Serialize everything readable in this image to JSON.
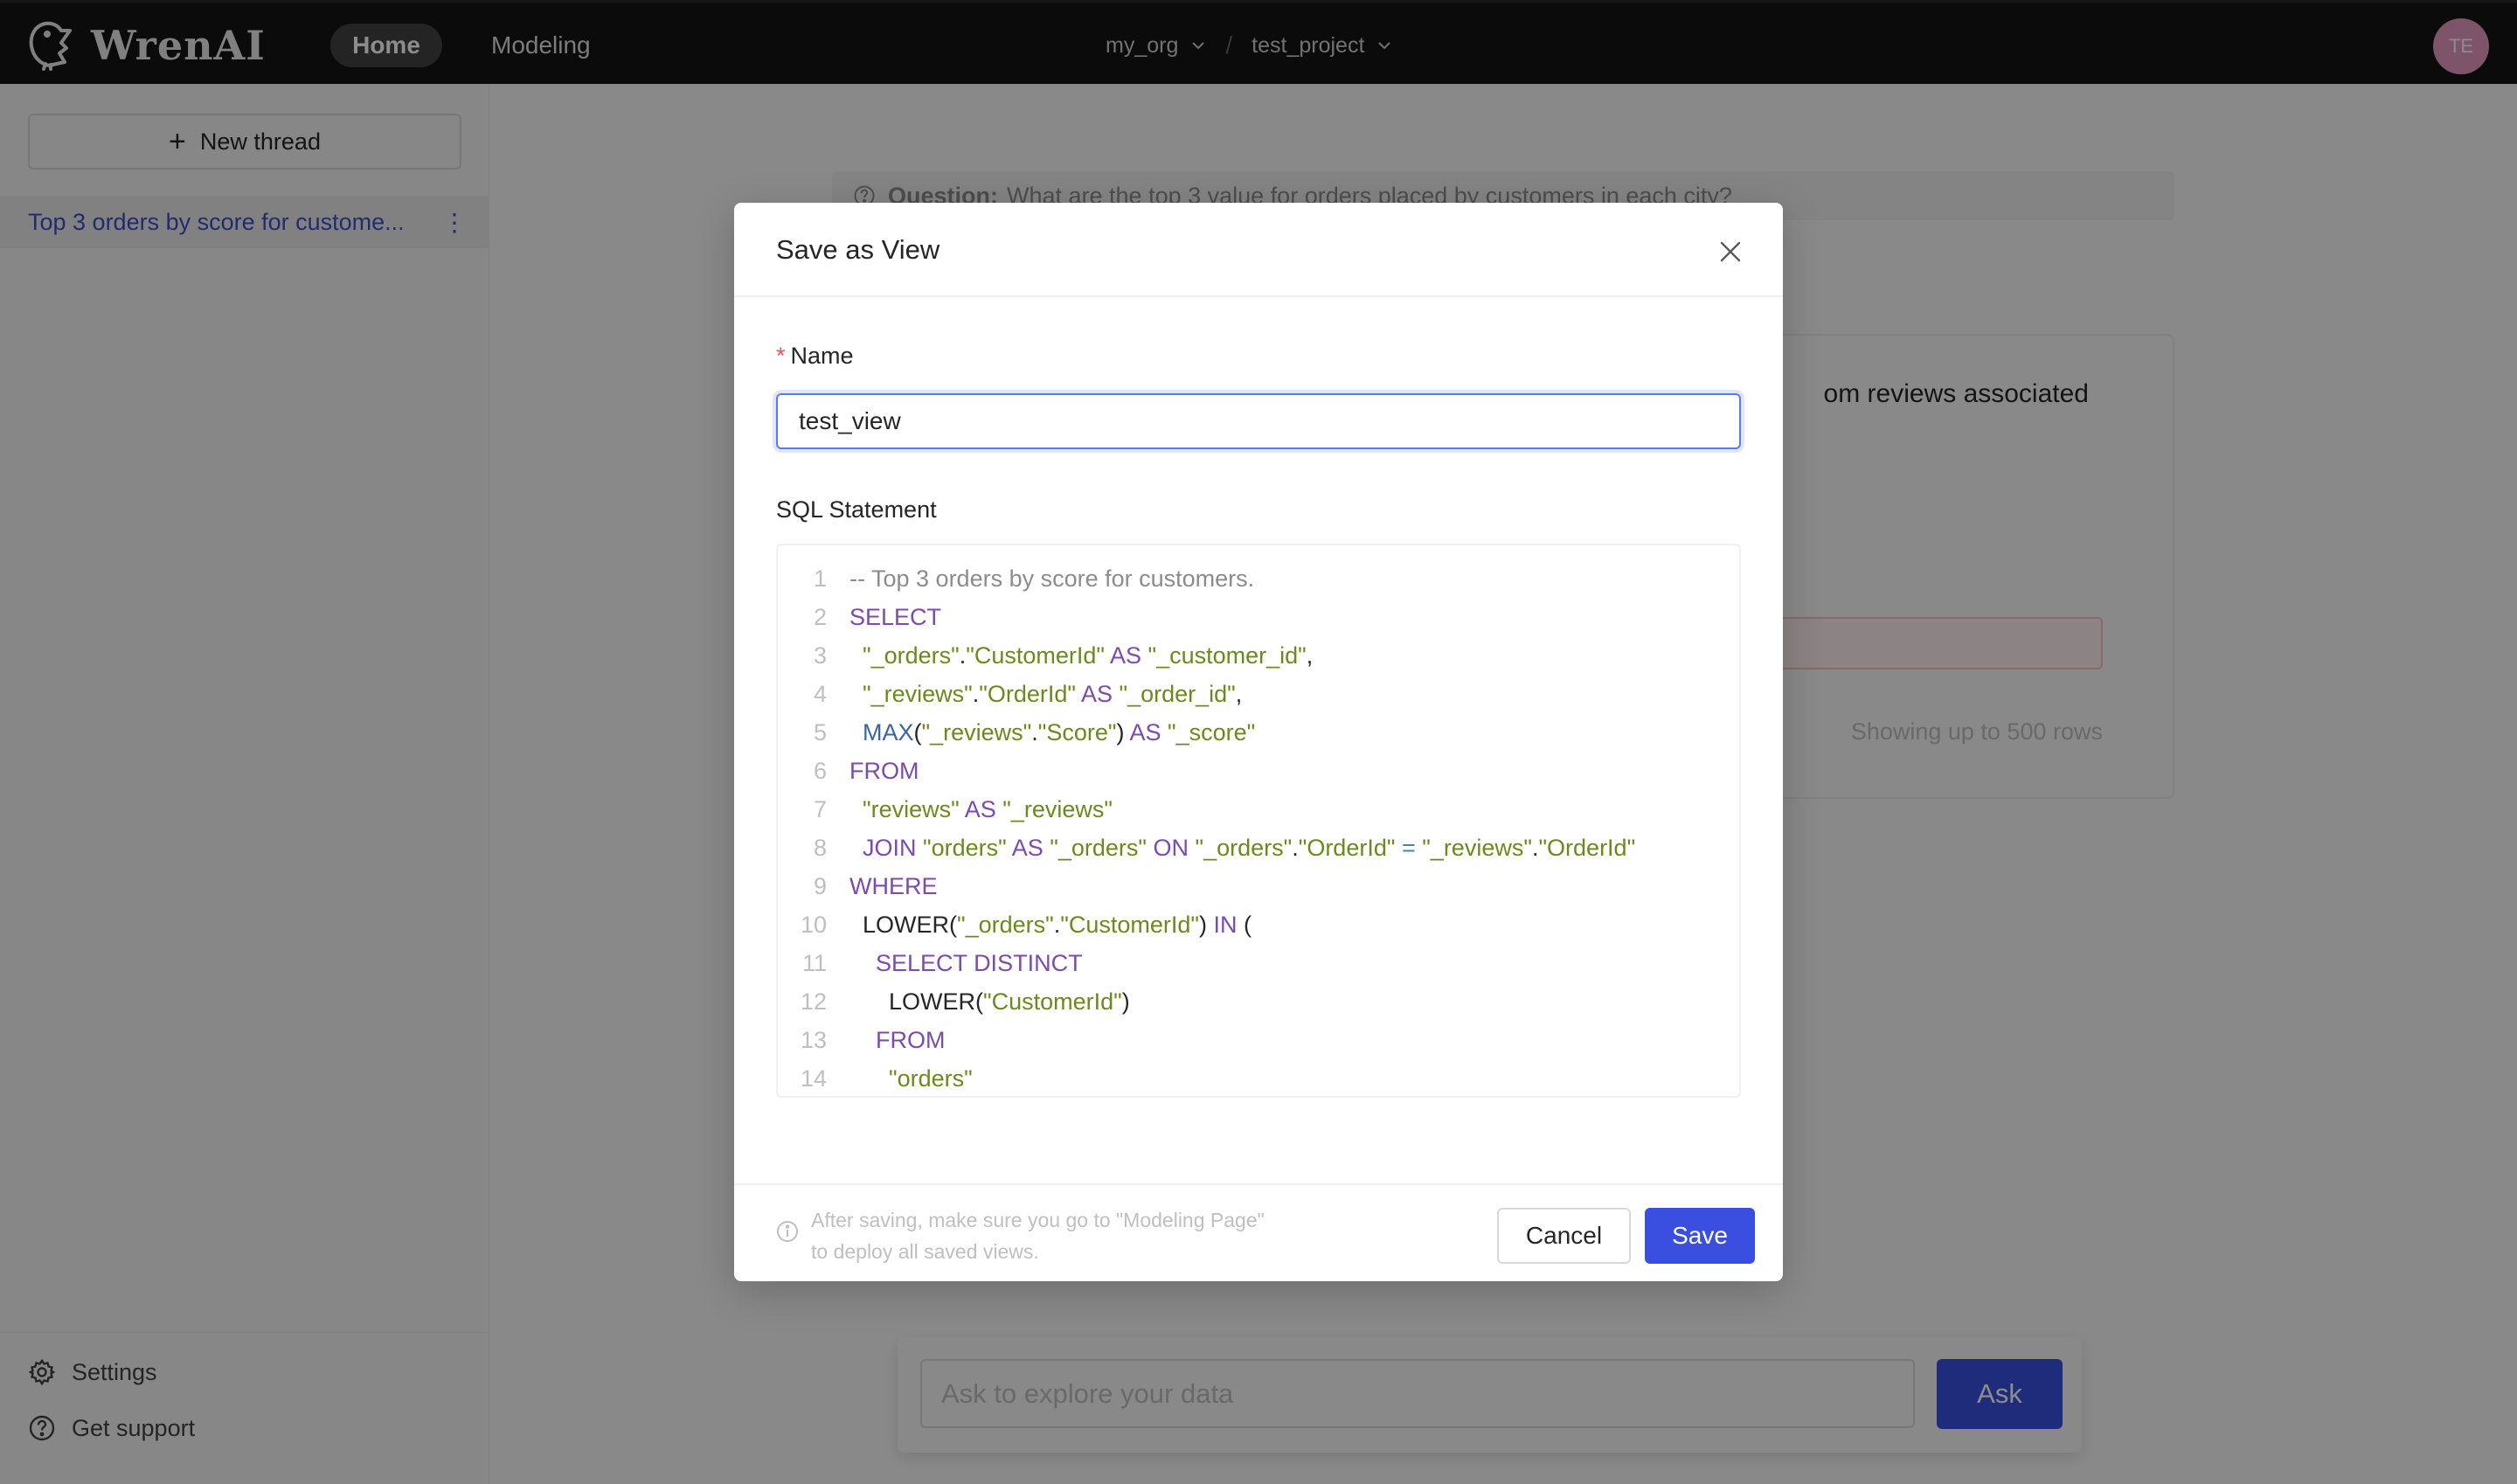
{
  "header": {
    "brand": "WrenAI",
    "nav": [
      {
        "label": "Home",
        "active": true
      },
      {
        "label": "Modeling",
        "active": false
      }
    ],
    "breadcrumb": {
      "org": "my_org",
      "separator": "/",
      "project": "test_project"
    },
    "avatar_initials": "TE",
    "avatar_color": "#e59ac2"
  },
  "sidebar": {
    "new_thread_label": "New thread",
    "threads": [
      {
        "label": "Top 3 orders by score for custome...",
        "active": true
      }
    ],
    "bottom_links": [
      {
        "label": "Settings",
        "icon": "gear-icon"
      },
      {
        "label": "Get support",
        "icon": "question-circle-icon"
      }
    ]
  },
  "main": {
    "question_label": "Question:",
    "question_text": "What are the top 3 value for orders placed by customers in each city?",
    "answer_text_visible": "om reviews associated",
    "rows_note": "Showing up to 500 rows",
    "ask": {
      "placeholder": "Ask to explore your data",
      "button_label": "Ask"
    }
  },
  "dialog": {
    "title": "Save as View",
    "name_label": "Name",
    "name_required_mark": "*",
    "name_value": "test_view",
    "sql_label": "SQL Statement",
    "sql_lines": [
      {
        "n": "1",
        "tokens": [
          {
            "t": "-- Top 3 orders by score for customers.",
            "c": "cm"
          }
        ]
      },
      {
        "n": "2",
        "tokens": [
          {
            "t": "SELECT",
            "c": "kw"
          }
        ]
      },
      {
        "n": "3",
        "tokens": [
          {
            "t": "  ",
            "c": "plain"
          },
          {
            "t": "\"_orders\"",
            "c": "str"
          },
          {
            "t": ".",
            "c": "plain"
          },
          {
            "t": "\"CustomerId\"",
            "c": "str"
          },
          {
            "t": " AS ",
            "c": "kw"
          },
          {
            "t": "\"_customer_id\"",
            "c": "str"
          },
          {
            "t": ",",
            "c": "plain"
          }
        ]
      },
      {
        "n": "4",
        "tokens": [
          {
            "t": "  ",
            "c": "plain"
          },
          {
            "t": "\"_reviews\"",
            "c": "str"
          },
          {
            "t": ".",
            "c": "plain"
          },
          {
            "t": "\"OrderId\"",
            "c": "str"
          },
          {
            "t": " AS ",
            "c": "kw"
          },
          {
            "t": "\"_order_id\"",
            "c": "str"
          },
          {
            "t": ",",
            "c": "plain"
          }
        ]
      },
      {
        "n": "5",
        "tokens": [
          {
            "t": "  ",
            "c": "plain"
          },
          {
            "t": "MAX",
            "c": "fn"
          },
          {
            "t": "(",
            "c": "plain"
          },
          {
            "t": "\"_reviews\"",
            "c": "str"
          },
          {
            "t": ".",
            "c": "plain"
          },
          {
            "t": "\"Score\"",
            "c": "str"
          },
          {
            "t": ")",
            "c": "plain"
          },
          {
            "t": " AS ",
            "c": "kw"
          },
          {
            "t": "\"_score\"",
            "c": "str"
          }
        ]
      },
      {
        "n": "6",
        "tokens": [
          {
            "t": "FROM",
            "c": "kw"
          }
        ]
      },
      {
        "n": "7",
        "tokens": [
          {
            "t": "  ",
            "c": "plain"
          },
          {
            "t": "\"reviews\"",
            "c": "str"
          },
          {
            "t": " AS ",
            "c": "kw"
          },
          {
            "t": "\"_reviews\"",
            "c": "str"
          }
        ]
      },
      {
        "n": "8",
        "tokens": [
          {
            "t": "  ",
            "c": "plain"
          },
          {
            "t": "JOIN ",
            "c": "kw"
          },
          {
            "t": "\"orders\"",
            "c": "str"
          },
          {
            "t": " AS ",
            "c": "kw"
          },
          {
            "t": "\"_orders\"",
            "c": "str"
          },
          {
            "t": " ON ",
            "c": "kw"
          },
          {
            "t": "\"_orders\"",
            "c": "str"
          },
          {
            "t": ".",
            "c": "plain"
          },
          {
            "t": "\"OrderId\"",
            "c": "str"
          },
          {
            "t": " = ",
            "c": "op"
          },
          {
            "t": "\"_reviews\"",
            "c": "str"
          },
          {
            "t": ".",
            "c": "plain"
          },
          {
            "t": "\"OrderId\"",
            "c": "str"
          }
        ]
      },
      {
        "n": "9",
        "tokens": [
          {
            "t": "WHERE",
            "c": "kw"
          }
        ]
      },
      {
        "n": "10",
        "tokens": [
          {
            "t": "  LOWER(",
            "c": "plain"
          },
          {
            "t": "\"_orders\"",
            "c": "str"
          },
          {
            "t": ".",
            "c": "plain"
          },
          {
            "t": "\"CustomerId\"",
            "c": "str"
          },
          {
            "t": ")",
            "c": "plain"
          },
          {
            "t": " IN ",
            "c": "kw"
          },
          {
            "t": "(",
            "c": "plain"
          }
        ]
      },
      {
        "n": "11",
        "tokens": [
          {
            "t": "    ",
            "c": "plain"
          },
          {
            "t": "SELECT DISTINCT",
            "c": "kw"
          }
        ]
      },
      {
        "n": "12",
        "tokens": [
          {
            "t": "      LOWER(",
            "c": "plain"
          },
          {
            "t": "\"CustomerId\"",
            "c": "str"
          },
          {
            "t": ")",
            "c": "plain"
          }
        ]
      },
      {
        "n": "13",
        "tokens": [
          {
            "t": "    ",
            "c": "plain"
          },
          {
            "t": "FROM",
            "c": "kw"
          }
        ]
      },
      {
        "n": "14",
        "tokens": [
          {
            "t": "      ",
            "c": "plain"
          },
          {
            "t": "\"orders\"",
            "c": "str"
          }
        ]
      }
    ],
    "footer_note": "After saving, make sure you go to \"Modeling Page\" to deploy all saved views.",
    "cancel_label": "Cancel",
    "save_label": "Save",
    "primary_color": "#3a4fe0"
  }
}
